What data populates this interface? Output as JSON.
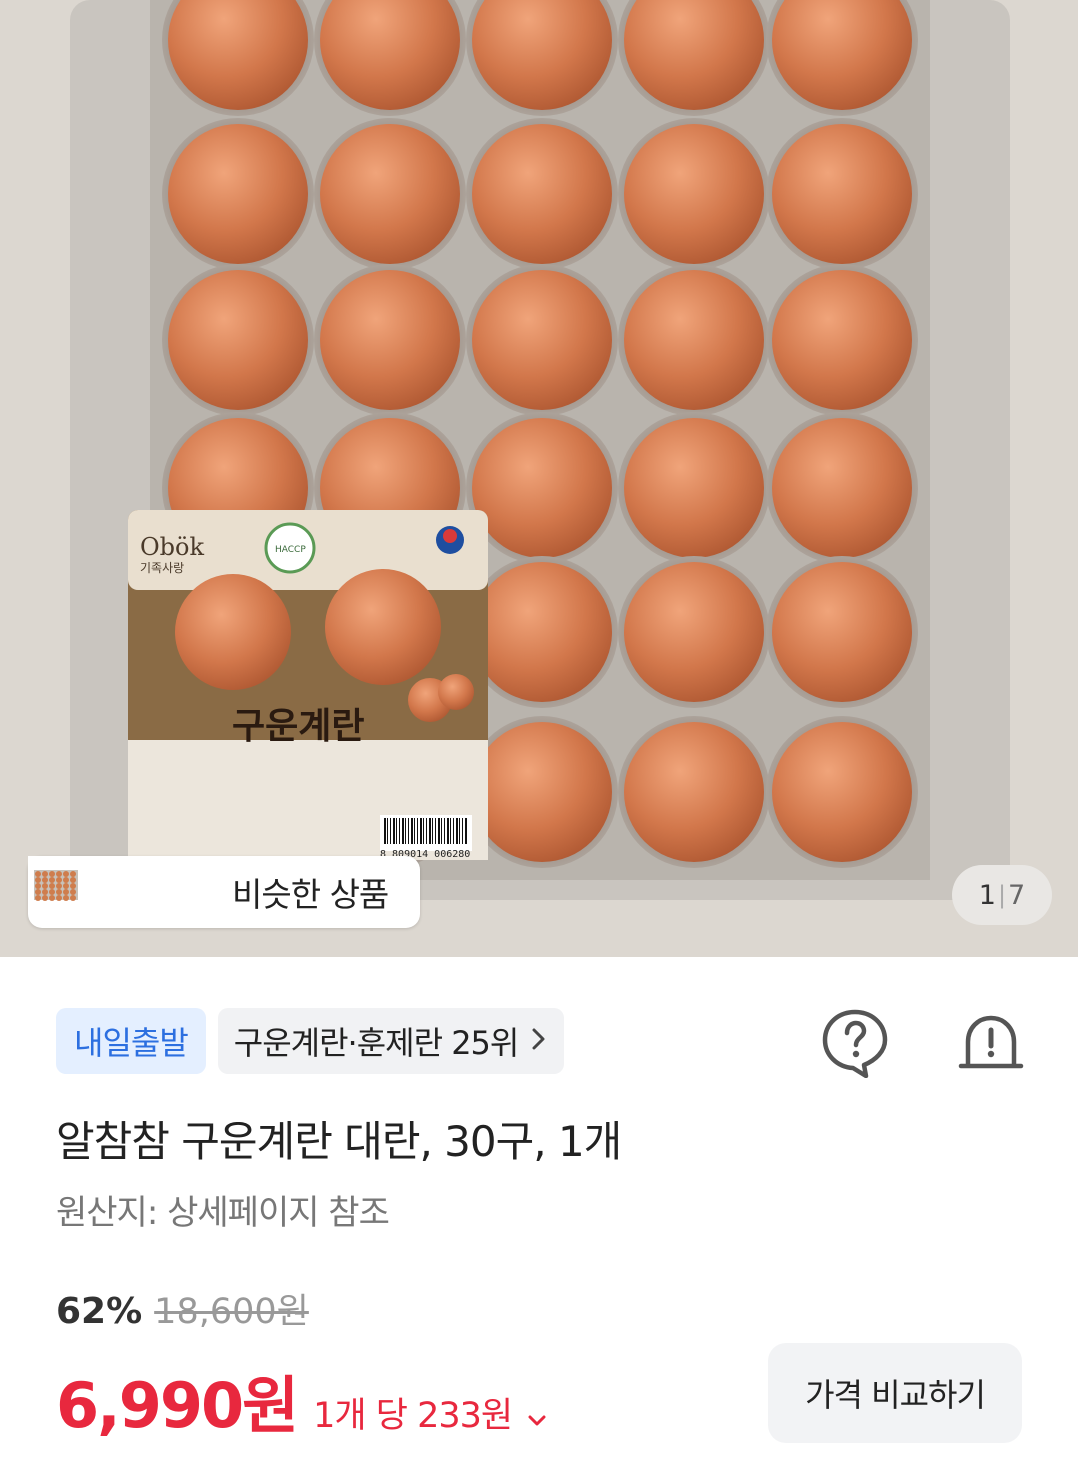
{
  "hero": {
    "label_brand": "Obök",
    "label_brand_sub": "기족사랑",
    "label_product": "구운계란",
    "label_badge": "HACCP",
    "label_barcode": "8 809014 006280"
  },
  "similar_products": {
    "label": "비슷한 상품",
    "thumbnails": [
      "roasted-egg-thumb",
      "egg-basket-thumb",
      "egg-tray-thumb"
    ]
  },
  "pager": {
    "current": "1",
    "total": "7"
  },
  "badges": {
    "delivery": "내일출발",
    "rank": "구운계란·훈제란 25위",
    "rank_icon": "chevron-right-icon"
  },
  "actions": {
    "question_icon": "question-icon",
    "report_icon": "alarm-icon"
  },
  "product": {
    "title": "알참참 구운계란 대란, 30구, 1개",
    "origin": "원산지: 상세페이지 참조"
  },
  "pricing": {
    "discount": "62%",
    "original_price": "18,600원",
    "price": "6,990원",
    "unit_price": "1개 당 233원",
    "compare_button": "가격 비교하기"
  },
  "colors": {
    "price_red": "#e8283e",
    "badge_blue": "#2c6fe0",
    "badge_blue_bg": "#e4efff"
  }
}
